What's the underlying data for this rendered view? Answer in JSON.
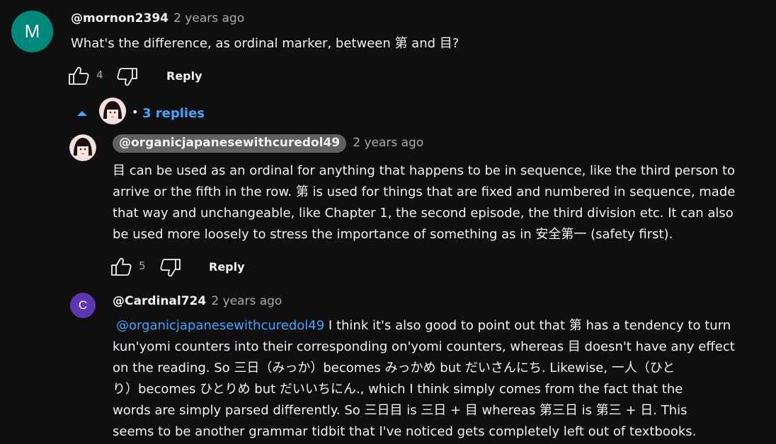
{
  "comment": {
    "avatar_letter": "M",
    "avatar_color": "#00897b",
    "handle": "@mornon2394",
    "time": "2 years ago",
    "text": "What's the difference, as ordinal marker, between 第 and 目?",
    "like_count": "4",
    "reply_label": "Reply"
  },
  "replies_toggle": {
    "label": "3 replies",
    "bullet": "•"
  },
  "reply1": {
    "handle": "@organicjapanesewithcuredol49",
    "time": "2 years ago",
    "lines": [
      "目 can be used as an ordinal for anything that happens to be in sequence, like the third person to",
      "arrive or the fifth in the row. 第 is used for things that are fixed and numbered in sequence, made",
      "that way and unchangeable, like Chapter 1, the second episode, the third division etc. It can also",
      "be used more loosely to stress the importance of something as in 安全第一 (safety first)."
    ],
    "like_count": "5",
    "reply_label": "Reply"
  },
  "reply2": {
    "avatar_letter": "C",
    "avatar_color": "#5e35b1",
    "handle": "@Cardinal724",
    "time": "2 years ago",
    "mention": "@organicjapanesewithcuredol49",
    "line1_rest": " I think it's also good to point out that  第 has a tendency to turn",
    "lines": [
      "kun'yomi counters into their corresponding on'yomi counters, whereas 目 doesn't have any effect",
      "on the reading. So 三日（みっか）becomes みっかめ but だいさんにち. Likewise, 一人（ひと",
      "り）becomes ひとりめ but だいいちにん., which I think simply comes from the fact that the",
      "words are simply parsed differently. So 三日目 is 三日 + 目 whereas 第三日 is 第三 + 日.  This",
      "seems to be another grammar tidbit that I've noticed gets completely left out of textbooks."
    ]
  },
  "colors": {
    "background": "#0f0f0f",
    "text": "#f1f1f1",
    "secondary": "#aaaaaa",
    "link": "#3ea6ff",
    "pill": "#606060"
  }
}
